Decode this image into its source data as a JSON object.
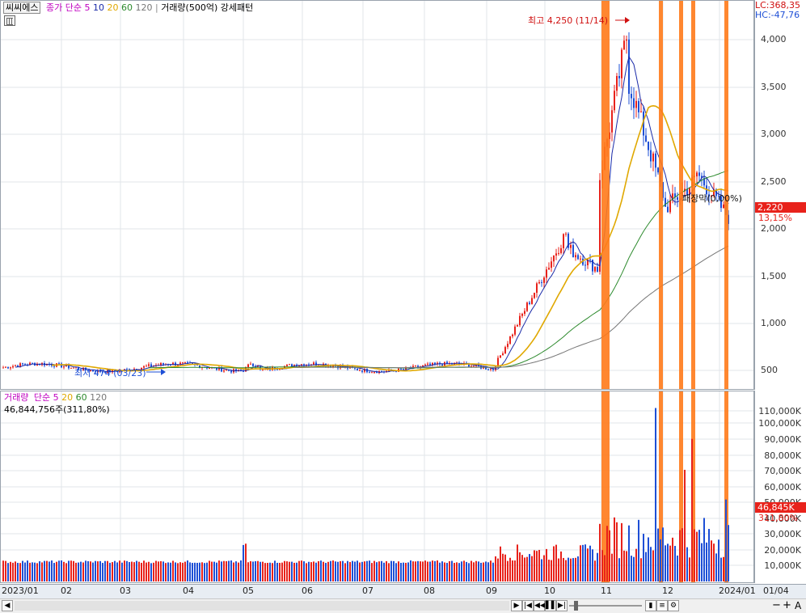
{
  "header": {
    "stock_name": "씨씨에스",
    "ma_label": "종가 단순",
    "ma_periods": [
      "5",
      "10",
      "20",
      "60",
      "120"
    ],
    "volume_label": "거래량(500억) 강세패턴",
    "lc": "LC:368,35",
    "hc": "HC:-47,76"
  },
  "annotations": {
    "high": "최고 4,250 (11/14)",
    "low": "최저 474 (03/23)",
    "pattern": "패장막(0,00%)"
  },
  "price_axis": {
    "ticks": [
      "4,000",
      "3,500",
      "3,000",
      "2,500",
      "2,000",
      "1,500",
      "1,000",
      "500"
    ],
    "current_price": "2,220",
    "current_change": "13,15%"
  },
  "volume_header": {
    "label": "거래량",
    "ma_label": "단순",
    "ma_periods": [
      "5",
      "20",
      "60",
      "120"
    ],
    "value": "46,844,756주(311,80%)"
  },
  "volume_axis": {
    "ticks": [
      "110,000K",
      "100,000K",
      "90,000K",
      "80,000K",
      "70,000K",
      "60,000K",
      "50,000K",
      "40,000K",
      "30,000K",
      "20,000K",
      "10,000K"
    ],
    "current_volume": "46,845K",
    "current_ratio": "311,80%"
  },
  "date_axis": {
    "labels": [
      "2023/01",
      "02",
      "03",
      "04",
      "05",
      "06",
      "07",
      "08",
      "09",
      "10",
      "11",
      "12",
      "2024/01",
      "01/04"
    ]
  },
  "colors": {
    "up": "#e8221b",
    "down": "#1e4fd6",
    "ma5": "#1a2aa8",
    "ma20": "#e0a800",
    "ma60": "#2d8a2d",
    "ma120": "#777777",
    "highlight": "#ff7a1a"
  },
  "chart_data": {
    "type": "candlestick",
    "price_ylim": [
      474,
      4250
    ],
    "high": {
      "value": 4250,
      "date": "11/14"
    },
    "low": {
      "value": 474,
      "date": "03/23"
    },
    "last_close": 2220,
    "volume_last": 46844756
  }
}
